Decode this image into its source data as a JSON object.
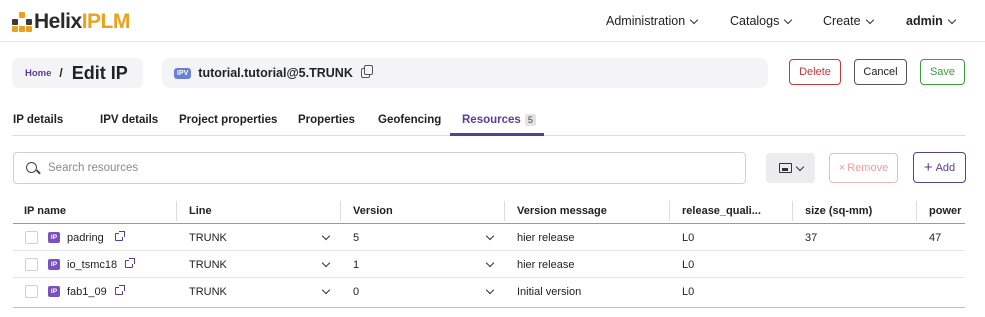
{
  "brand": {
    "name_main": "Helix",
    "name_accent": "IPLM",
    "mark_colors": [
      "#e8a21b",
      "#3a3a3a",
      "#e8a21b",
      "#3a3a3a"
    ]
  },
  "nav": [
    {
      "label": "Administration"
    },
    {
      "label": "Catalogs"
    },
    {
      "label": "Create"
    },
    {
      "label": "admin"
    }
  ],
  "header": {
    "breadcrumb_home": "Home",
    "breadcrumb_sep": "/",
    "title": "Edit IP",
    "ipv_badge": "IPV",
    "ipv_name": "tutorial.tutorial@5.TRUNK"
  },
  "actions": {
    "delete": "Delete",
    "cancel": "Cancel",
    "save": "Save"
  },
  "tabs": [
    {
      "label": "IP details"
    },
    {
      "label": "IPV details"
    },
    {
      "label": "Project properties"
    },
    {
      "label": "Properties"
    },
    {
      "label": "Geofencing"
    },
    {
      "label": "Resources",
      "count": "5",
      "active": true
    }
  ],
  "toolbar": {
    "search_placeholder": "Search resources",
    "remove_label": "Remove",
    "add_label": "Add",
    "remove_icon": "×",
    "add_icon": "+"
  },
  "table": {
    "columns": [
      "IP name",
      "Line",
      "Version",
      "Version message",
      "release_quali...",
      "size (sq-mm)",
      "power r"
    ],
    "rows": [
      {
        "badge": "IP",
        "name": "padring",
        "line": "TRUNK",
        "version": "5",
        "message": "hier release",
        "release": "L0",
        "size": "37",
        "power": "47"
      },
      {
        "badge": "IP",
        "name": "io_tsmc18",
        "line": "TRUNK",
        "version": "1",
        "message": "hier release",
        "release": "L0",
        "size": "",
        "power": ""
      },
      {
        "badge": "IP",
        "name": "fab1_09",
        "line": "TRUNK",
        "version": "0",
        "message": "Initial version",
        "release": "L0",
        "size": "",
        "power": ""
      }
    ]
  },
  "colors": {
    "accent": "#5a3e96",
    "danger": "#c03a3a",
    "success": "#3f9a3f",
    "ipv_badge": "#6b7fd3",
    "ip_badge": "#7a52c0"
  }
}
